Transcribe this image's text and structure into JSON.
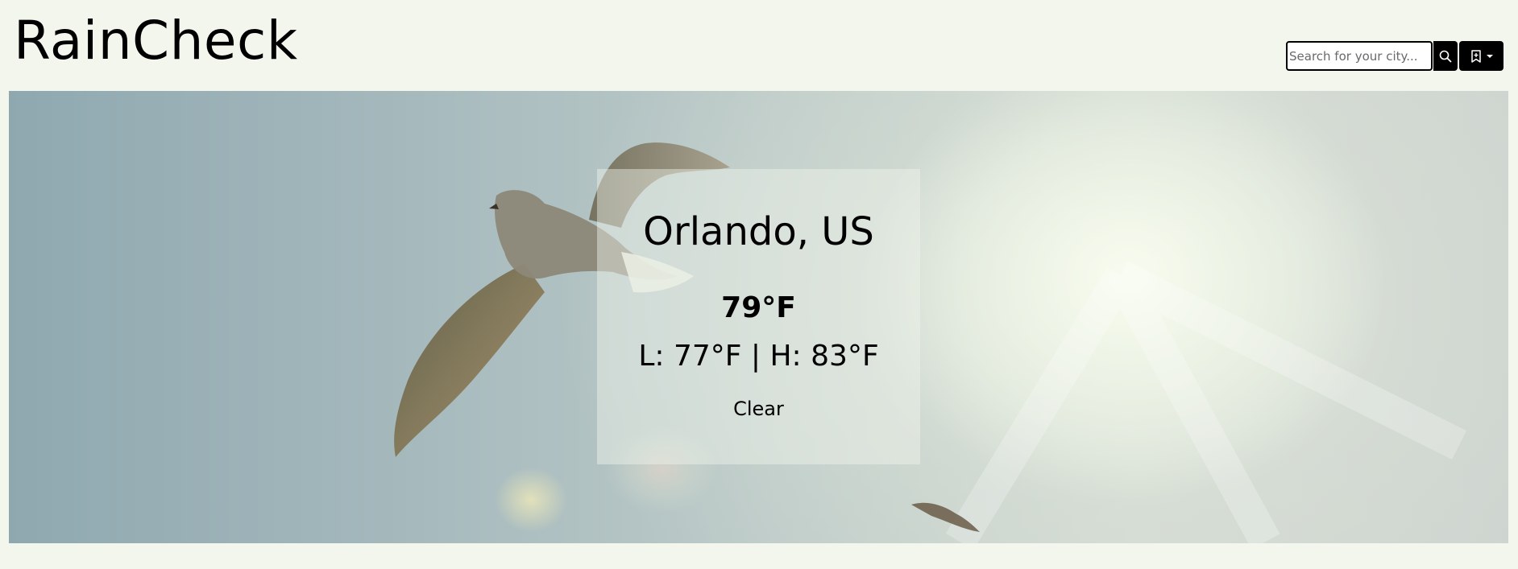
{
  "header": {
    "brand": "RainCheck"
  },
  "search": {
    "placeholder": "Search for your city...",
    "value": "",
    "search_icon": "search-icon",
    "bookmark_icon": "bookmark-icon",
    "dropdown_icon": "caret-down-icon"
  },
  "weather": {
    "city": "Orlando, US",
    "temperature": "79°F",
    "low_high": "L: 77°F | H: 83°F",
    "condition": "Clear"
  },
  "colors": {
    "background": "#f3f6ec",
    "button": "#000000",
    "card": "rgba(240,244,236,0.45)"
  }
}
